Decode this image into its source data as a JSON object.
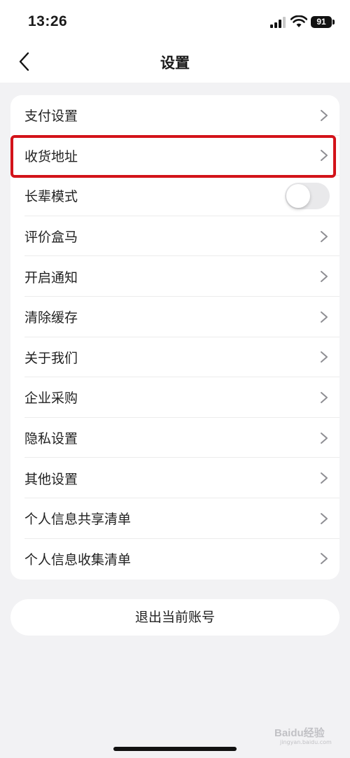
{
  "status_bar": {
    "time": "13:26",
    "battery": "91"
  },
  "nav": {
    "title": "设置"
  },
  "settings": {
    "items": [
      {
        "label": "支付设置",
        "control": "chevron-right-icon"
      },
      {
        "label": "收货地址",
        "control": "chevron-right-icon",
        "highlighted": true
      },
      {
        "label": "长辈模式",
        "control": "toggle",
        "toggle_on": false
      },
      {
        "label": "评价盒马",
        "control": "chevron-right-icon"
      },
      {
        "label": "开启通知",
        "control": "chevron-right-icon"
      },
      {
        "label": "清除缓存",
        "control": "chevron-right-icon"
      },
      {
        "label": "关于我们",
        "control": "chevron-right-icon"
      },
      {
        "label": "企业采购",
        "control": "chevron-right-icon"
      },
      {
        "label": "隐私设置",
        "control": "chevron-right-icon"
      },
      {
        "label": "其他设置",
        "control": "chevron-right-icon"
      },
      {
        "label": "个人信息共享清单",
        "control": "chevron-right-icon"
      },
      {
        "label": "个人信息收集清单",
        "control": "chevron-right-icon"
      }
    ]
  },
  "logout": {
    "label": "退出当前账号"
  },
  "watermark": {
    "text": "Baidu经验",
    "sub": "jingyan.baidu.com"
  },
  "colors": {
    "highlight": "#d3131a",
    "background": "#f2f2f4",
    "card": "#ffffff",
    "toggle_off": "#e9e9eb"
  }
}
